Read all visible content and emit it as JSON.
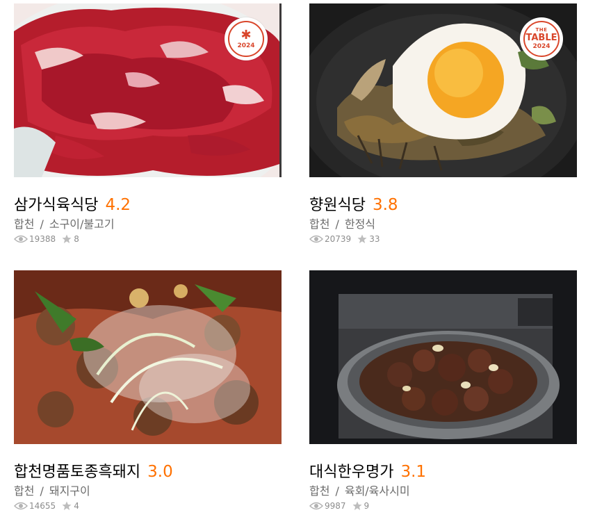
{
  "restaurants": [
    {
      "name": "삼가식육식당",
      "score": "4.2",
      "region": "합천",
      "category": "소구이/불고기",
      "views": "19388",
      "reviews": "8",
      "badge": {
        "top": "",
        "mid": "",
        "year": "2024",
        "icon": "asterisk-icon"
      }
    },
    {
      "name": "향원식당",
      "score": "3.8",
      "region": "합천",
      "category": "한정식",
      "views": "20739",
      "reviews": "33",
      "badge": {
        "top": "THE",
        "mid": "TABLE",
        "year": "2024"
      }
    },
    {
      "name": "합천명품토종흑돼지",
      "score": "3.0",
      "region": "합천",
      "category": "돼지구이",
      "views": "14655",
      "reviews": "4"
    },
    {
      "name": "대식한우명가",
      "score": "3.1",
      "region": "합천",
      "category": "육회/육사시미",
      "views": "9987",
      "reviews": "9"
    }
  ],
  "separator": "/",
  "colors": {
    "score": "#ff7100",
    "badge": "#d9462b",
    "meta": "#6b6b6b",
    "stats": "#8c8c8c"
  }
}
